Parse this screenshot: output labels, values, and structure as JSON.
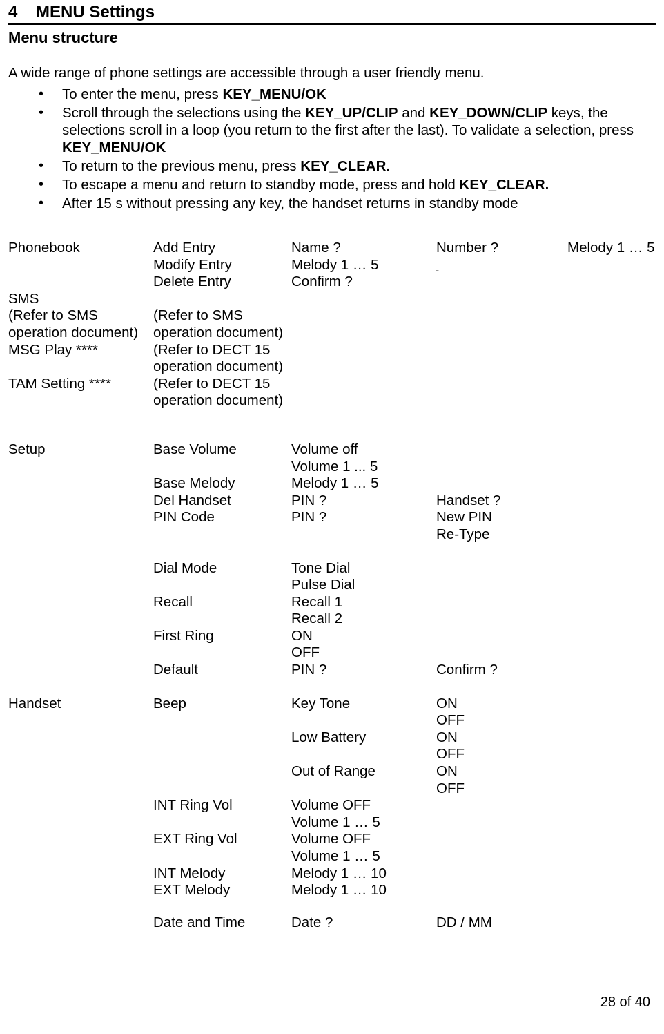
{
  "section_number": "4",
  "section_title": "MENU Settings",
  "subsection": "Menu structure",
  "intro": "A wide range of phone settings are accessible through a user friendly menu.",
  "bullets": [
    {
      "pre": "To enter the menu, press ",
      "b1": "KEY_MENU/OK",
      "mid": "",
      "b2": "",
      "post": ""
    },
    {
      "pre": "Scroll through the selections using the ",
      "b1": "KEY_UP/CLIP",
      "mid": " and ",
      "b2": "KEY_DOWN/CLIP",
      "post": " keys, the selections scroll in a loop (you return to the first after the last). To validate a selection, press ",
      "b3": "KEY_MENU/OK"
    },
    {
      "pre": "To return to the previous menu, press ",
      "b1": "KEY_CLEAR.",
      "mid": "",
      "b2": "",
      "post": ""
    },
    {
      "pre": "To escape a menu and return to standby mode, press and hold ",
      "b1": "KEY_CLEAR.",
      "mid": "",
      "b2": "",
      "post": ""
    },
    {
      "pre": "After 15 s without pressing any key, the handset returns in standby mode",
      "b1": "",
      "mid": "",
      "b2": "",
      "post": ""
    }
  ],
  "table": {
    "r1": {
      "c1": "Phonebook",
      "c2": "Add Entry",
      "c3": "Name ?",
      "c4": "Number ?",
      "c5": "Melody 1 … 5"
    },
    "r2": {
      "c1": "",
      "c2": "Modify Entry",
      "c3": "Melody 1 … 5",
      "c4u": "_",
      "c5": ""
    },
    "r3": {
      "c1": "",
      "c2": "Delete Entry",
      "c3": "Confirm ?",
      "c4": "",
      "c5": ""
    },
    "r4": {
      "c1": "SMS",
      "c2": "",
      "c3": "",
      "c4": "",
      "c5": ""
    },
    "r5": {
      "c1": "(Refer to SMS operation document)",
      "c2": "(Refer to SMS operation document)",
      "c3": "",
      "c4": "",
      "c5": ""
    },
    "r6": {
      "c1": "MSG Play ****",
      "c2": "(Refer to DECT 15 operation document)",
      "c3": "",
      "c4": "",
      "c5": ""
    },
    "r7": {
      "c1": "TAM Setting ****",
      "c2": "(Refer to DECT 15 operation document)",
      "c3": "",
      "c4": "",
      "c5": ""
    },
    "r8": {
      "c1": "Setup",
      "c2": "Base Volume",
      "c3": "Volume off",
      "c4": "",
      "c5": ""
    },
    "r9": {
      "c1": "",
      "c2": "",
      "c3": "Volume 1 ... 5",
      "c4": "",
      "c5": ""
    },
    "r10": {
      "c1": "",
      "c2": "Base Melody",
      "c3": "Melody 1 … 5",
      "c4": "",
      "c5": ""
    },
    "r11": {
      "c1": "",
      "c2": "Del Handset",
      "c3": "PIN ?",
      "c4": "Handset ?",
      "c5": ""
    },
    "r12": {
      "c1": "",
      "c2": "PIN Code",
      "c3": "PIN ?",
      "c4": "New PIN",
      "c5": ""
    },
    "r13": {
      "c1": "",
      "c2": "",
      "c3": "",
      "c4": "Re-Type",
      "c5": ""
    },
    "r14": {
      "c1": "",
      "c2": "Dial Mode",
      "c3": "Tone Dial",
      "c4": "",
      "c5": ""
    },
    "r15": {
      "c1": "",
      "c2": "",
      "c3": "Pulse Dial",
      "c4": "",
      "c5": ""
    },
    "r16": {
      "c1": "",
      "c2": "Recall",
      "c3": "Recall 1",
      "c4": "",
      "c5": ""
    },
    "r17": {
      "c1": "",
      "c2": "",
      "c3": "Recall 2",
      "c4": "",
      "c5": ""
    },
    "r18": {
      "c1": "",
      "c2": "First Ring",
      "c3": "ON",
      "c4": "",
      "c5": ""
    },
    "r19": {
      "c1": "",
      "c2": "",
      "c3": "OFF",
      "c4": "",
      "c5": ""
    },
    "r20": {
      "c1": "",
      "c2": "Default",
      "c3": "PIN ?",
      "c4": "Confirm ?",
      "c5": ""
    },
    "r21": {
      "c1": "Handset",
      "c2": "Beep",
      "c3": "Key Tone",
      "c4": "ON",
      "c5": ""
    },
    "r22": {
      "c1": "",
      "c2": "",
      "c3": "",
      "c4": "OFF",
      "c5": ""
    },
    "r23": {
      "c1": "",
      "c2": "",
      "c3": "Low Battery",
      "c4": "ON",
      "c5": ""
    },
    "r24": {
      "c1": "",
      "c2": "",
      "c3": "",
      "c4": "OFF",
      "c5": ""
    },
    "r25": {
      "c1": "",
      "c2": "",
      "c3": "Out of Range",
      "c4": "ON",
      "c5": ""
    },
    "r26": {
      "c1": "",
      "c2": "",
      "c3": "",
      "c4": "OFF",
      "c5": ""
    },
    "r27": {
      "c1": "",
      "c2": "INT Ring Vol",
      "c3": "Volume OFF",
      "c4": "",
      "c5": ""
    },
    "r28": {
      "c1": "",
      "c2": "",
      "c3": "Volume 1 … 5",
      "c4": "",
      "c5": ""
    },
    "r29": {
      "c1": "",
      "c2": "EXT Ring Vol",
      "c3": "Volume OFF",
      "c4": "",
      "c5": ""
    },
    "r30": {
      "c1": "",
      "c2": "",
      "c3": "Volume 1 … 5",
      "c4": "",
      "c5": ""
    },
    "r31": {
      "c1": "",
      "c2": "INT Melody",
      "c3": "Melody 1 … 10",
      "c4": "",
      "c5": ""
    },
    "r32": {
      "c1": "",
      "c2": "EXT Melody",
      "c3": "Melody 1 … 10",
      "c4": "",
      "c5": ""
    },
    "r33": {
      "c1": "",
      "c2": "Date and Time",
      "c3": "Date ?",
      "c4": "DD / MM",
      "c5": ""
    }
  },
  "page_num": "28 of 40"
}
